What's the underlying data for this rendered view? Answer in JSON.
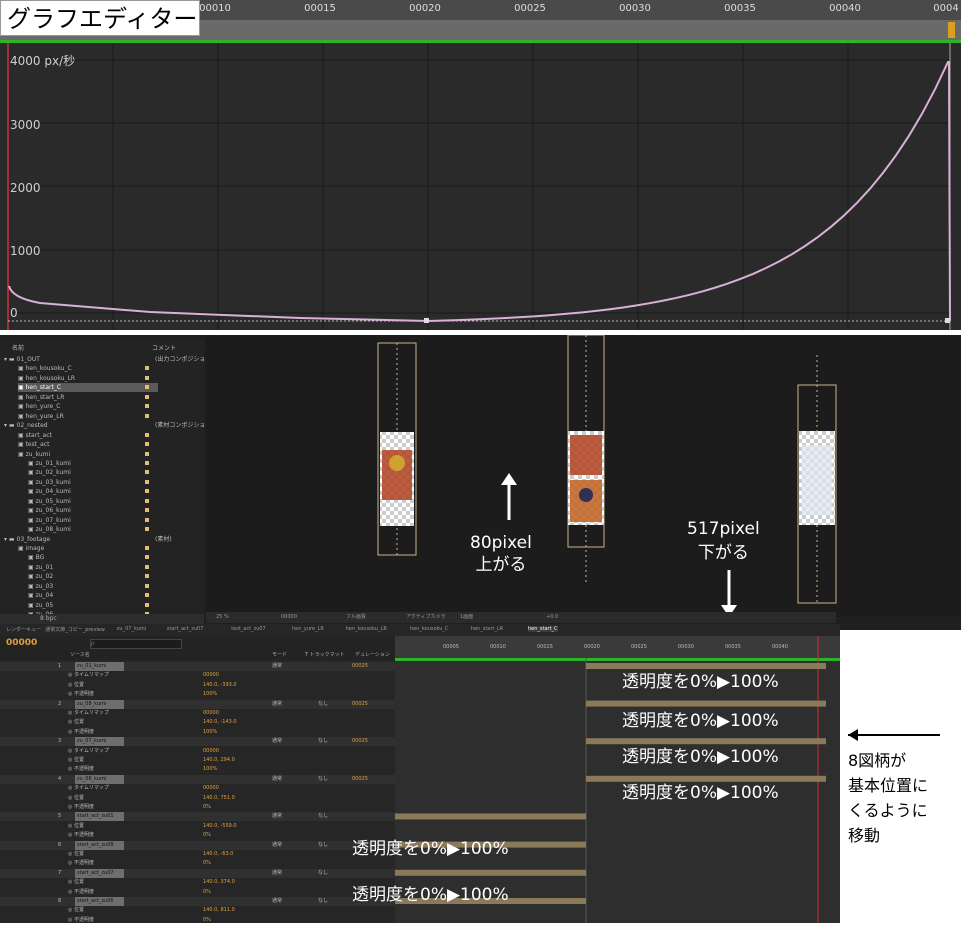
{
  "graph_editor": {
    "title": "グラフエディター",
    "ruler_labels": [
      "00010",
      "00015",
      "00020",
      "00025",
      "00030",
      "00035",
      "00040",
      "0004"
    ],
    "y_labels": [
      "4000 px/秒",
      "3000",
      "2000",
      "1000",
      "0"
    ]
  },
  "chart_data": {
    "type": "line",
    "ylabel": "px/秒",
    "ylim": [
      0,
      4000
    ],
    "x_ticks": [
      "00010",
      "00015",
      "00020",
      "00025",
      "00030",
      "00035",
      "00040"
    ],
    "series": [
      {
        "values_note": "",
        "values": [
          0,
          600,
          150,
          60,
          0,
          400,
          900,
          1600,
          2600,
          4000
        ]
      }
    ]
  },
  "project": {
    "columns": {
      "name": "名前",
      "comment": "コメント"
    },
    "rows": [
      {
        "label": "01_OUT",
        "comment": "(出力コンポジショ",
        "folder": true
      },
      {
        "label": "hen_kousoku_C",
        "color": "#e0c070"
      },
      {
        "label": "hen_kousoku_LR",
        "color": "#e0c070"
      },
      {
        "label": "hen_start_C",
        "color": "#e0c070",
        "selected": true
      },
      {
        "label": "hen_start_LR",
        "color": "#e0c070"
      },
      {
        "label": "hen_yure_C",
        "color": "#e0c070"
      },
      {
        "label": "hen_yure_LR",
        "color": "#e0c070"
      },
      {
        "label": "02_nested",
        "comment": "(素材コンポジショ",
        "folder": true
      },
      {
        "label": "start_act",
        "color": "#e0c070"
      },
      {
        "label": "test_act",
        "color": "#e0c070"
      },
      {
        "label": "zu_kumi",
        "color": "#e0c070"
      },
      {
        "label": "zu_01_kumi",
        "color": "#e0c070"
      },
      {
        "label": "zu_02_kumi",
        "color": "#e0c070"
      },
      {
        "label": "zu_03_kumi",
        "color": "#e0c070"
      },
      {
        "label": "zu_04_kumi",
        "color": "#e0c070"
      },
      {
        "label": "zu_05_kumi",
        "color": "#e0c070"
      },
      {
        "label": "zu_06_kumi",
        "color": "#e0c070"
      },
      {
        "label": "zu_07_kumi",
        "color": "#e0c070"
      },
      {
        "label": "zu_08_kumi",
        "color": "#e0c070"
      },
      {
        "label": "03_footage",
        "comment": "(素材)",
        "folder": true
      },
      {
        "label": "image",
        "color": "#e0c070"
      },
      {
        "label": "BG",
        "color": "#e0c070"
      },
      {
        "label": "zu_01",
        "color": "#e0c070"
      },
      {
        "label": "zu_02",
        "color": "#e0c070"
      },
      {
        "label": "zu_03",
        "color": "#e0c070"
      },
      {
        "label": "zu_04",
        "color": "#e0c070"
      },
      {
        "label": "zu_05",
        "color": "#e0c070"
      },
      {
        "label": "zu_06",
        "color": "#e0c070"
      }
    ],
    "footer": "8 bpc"
  },
  "viewer": {
    "zoom": "25 %",
    "time": "00000",
    "quality": "フル画質",
    "camera": "アクティブカメラ",
    "views": "1画面",
    "exposure": "+0.0"
  },
  "timeline": {
    "tabs": [
      "レンダーキュー",
      "通常文節_コピー_preview",
      "zu_07_kumi",
      "start_act_zu07",
      "test_act_zu07",
      "hen_yure_LR",
      "hen_kousoku_LR",
      "hen_kousoku_C",
      "hen_start_LR",
      "hen_start_C"
    ],
    "timecode": "00000",
    "search_placeholder": "ρ",
    "columns": {
      "source": "ソース名",
      "mode": "モード",
      "trkmat": "T トラックマット",
      "duration": "デュレーション"
    },
    "ruler": [
      "00005",
      "00010",
      "00015",
      "00020",
      "00025",
      "00030",
      "00035",
      "00040"
    ],
    "layers": [
      {
        "num": "1",
        "name": "zu_01_kumi",
        "mode": "通常",
        "matte": "",
        "duration": "00025",
        "props": [
          {
            "label": "タイムリマップ",
            "value": "00000"
          },
          {
            "label": "位置",
            "value": "140.0, -393.0"
          },
          {
            "label": "不透明度",
            "value": "100%"
          }
        ]
      },
      {
        "num": "2",
        "name": "zu_08_kumi",
        "mode": "通常",
        "matte": "なし",
        "duration": "00025",
        "props": [
          {
            "label": "タイムリマップ",
            "value": "00000"
          },
          {
            "label": "位置",
            "value": "140.0, -143.0"
          },
          {
            "label": "不透明度",
            "value": "100%"
          }
        ]
      },
      {
        "num": "3",
        "name": "zu_07_kumi",
        "mode": "通常",
        "matte": "なし",
        "duration": "00025",
        "props": [
          {
            "label": "タイムリマップ",
            "value": "00000"
          },
          {
            "label": "位置",
            "value": "140.0, 294.0"
          },
          {
            "label": "不透明度",
            "value": "100%"
          }
        ]
      },
      {
        "num": "4",
        "name": "zu_06_kumi",
        "mode": "通常",
        "matte": "なし",
        "duration": "00025",
        "props": [
          {
            "label": "タイムリマップ",
            "value": "00000"
          },
          {
            "label": "位置",
            "value": "140.0, 751.0"
          },
          {
            "label": "不透明度",
            "value": "0%"
          }
        ]
      },
      {
        "num": "5",
        "name": "start_act_zu01",
        "mode": "通常",
        "matte": "なし",
        "duration": "",
        "props": [
          {
            "label": "位置",
            "value": "140.0, -559.0"
          },
          {
            "label": "不透明度",
            "value": "0%"
          }
        ]
      },
      {
        "num": "6",
        "name": "start_act_zu08",
        "mode": "通常",
        "matte": "なし",
        "duration": "",
        "props": [
          {
            "label": "位置",
            "value": "140.0, -63.0"
          },
          {
            "label": "不透明度",
            "value": "0%"
          }
        ]
      },
      {
        "num": "7",
        "name": "start_act_zu07",
        "mode": "通常",
        "matte": "なし",
        "duration": "",
        "props": [
          {
            "label": "位置",
            "value": "140.0, 374.0"
          },
          {
            "label": "不透明度",
            "value": "0%"
          }
        ]
      },
      {
        "num": "8",
        "name": "start_act_zu06",
        "mode": "通常",
        "matte": "なし",
        "duration": "",
        "props": [
          {
            "label": "位置",
            "value": "140.0, 811.0"
          },
          {
            "label": "不透明度",
            "value": "0%"
          }
        ]
      }
    ]
  },
  "annotations": {
    "up": "80pixel\n上がる",
    "up_l1": "80pixel",
    "up_l2": "上がる",
    "down_l1": "517pixel",
    "down_l2": "下がる",
    "opacity": "透明度を0%▶100%",
    "side_l1": "8図柄が",
    "side_l2": "基本位置に",
    "side_l3": "くるように",
    "side_l4": "移動"
  }
}
